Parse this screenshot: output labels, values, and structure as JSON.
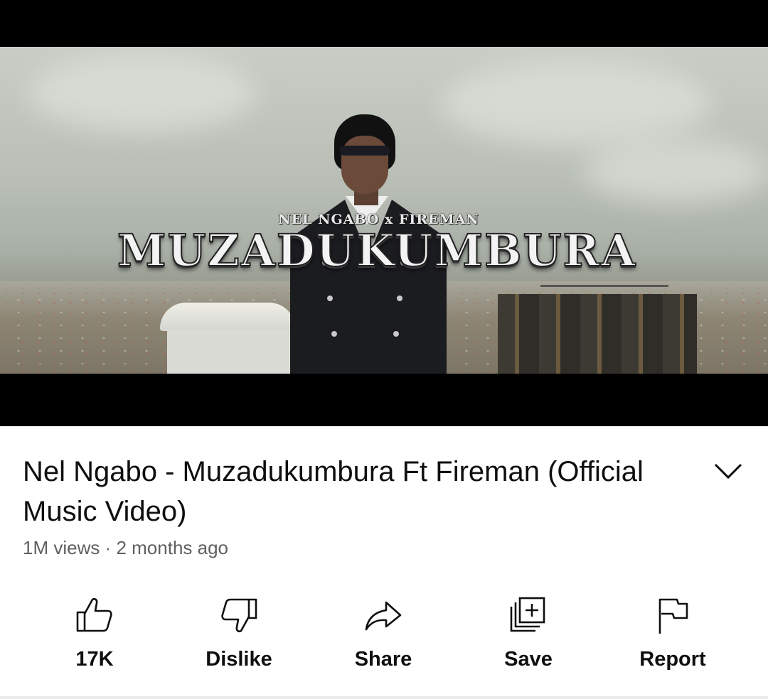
{
  "video": {
    "overlay_artists": "NEL NGABO x FIREMAN",
    "overlay_title": "MUZADUKUMBURA"
  },
  "details": {
    "title": "Nel Ngabo - Muzadukumbura Ft Fireman (Official Music Video)",
    "meta": "1M views · 2 months ago",
    "expand_icon": "chevron-down-icon"
  },
  "actions": [
    {
      "label": "17K",
      "icon": "thumbs-up-icon"
    },
    {
      "label": "Dislike",
      "icon": "thumbs-down-icon"
    },
    {
      "label": "Share",
      "icon": "share-icon"
    },
    {
      "label": "Save",
      "icon": "save-playlist-icon"
    },
    {
      "label": "Report",
      "icon": "flag-icon"
    }
  ]
}
